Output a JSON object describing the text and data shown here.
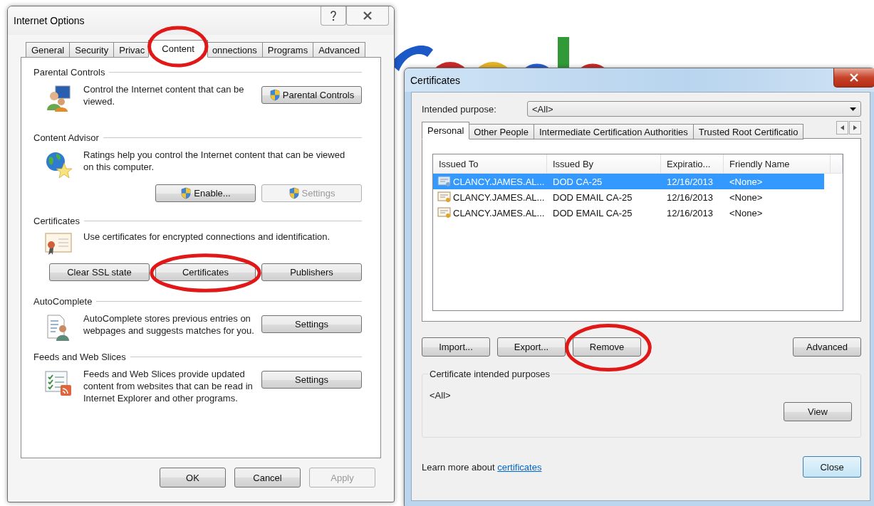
{
  "options_window": {
    "title": "Internet Options",
    "tabs": [
      {
        "label": "General",
        "selected": false
      },
      {
        "label": "Security",
        "selected": false
      },
      {
        "label": "Privac",
        "selected": false
      },
      {
        "label": "Content",
        "selected": true
      },
      {
        "label": "onnections",
        "selected": false
      },
      {
        "label": "Programs",
        "selected": false
      },
      {
        "label": "Advanced",
        "selected": false
      }
    ],
    "sections": [
      {
        "kind": "parental",
        "title": "Parental Controls",
        "text": "Control the Internet content that can be viewed.",
        "buttons": [
          {
            "label": "Parental Controls",
            "shield": true,
            "disabled": false
          }
        ]
      },
      {
        "kind": "advisor",
        "title": "Content Advisor",
        "text": "Ratings help you control the Internet content that can be viewed on this computer.",
        "buttons": [
          {
            "label": "Enable...",
            "shield": true,
            "disabled": false
          },
          {
            "label": "Settings",
            "shield": true,
            "disabled": true
          }
        ]
      },
      {
        "kind": "certificates",
        "title": "Certificates",
        "text": "Use certificates for encrypted connections and identification.",
        "buttons": [
          {
            "label": "Clear SSL state",
            "shield": false,
            "disabled": false
          },
          {
            "label": "Certificates",
            "shield": false,
            "disabled": false
          },
          {
            "label": "Publishers",
            "shield": false,
            "disabled": false
          }
        ]
      },
      {
        "kind": "autocomplete",
        "title": "AutoComplete",
        "text": "AutoComplete stores previous entries on webpages and suggests matches for you.",
        "buttons": [
          {
            "label": "Settings",
            "shield": false,
            "disabled": false
          }
        ]
      },
      {
        "kind": "feeds",
        "title": "Feeds and Web Slices",
        "text": "Feeds and Web Slices provide updated content from websites that can be read in Internet Explorer and other programs.",
        "buttons": [
          {
            "label": "Settings",
            "shield": false,
            "disabled": false
          }
        ]
      }
    ],
    "footer_buttons": [
      {
        "label": "OK",
        "disabled": false
      },
      {
        "label": "Cancel",
        "disabled": false
      },
      {
        "label": "Apply",
        "disabled": true
      }
    ]
  },
  "certificates_window": {
    "title": "Certificates",
    "purpose_label": "Intended purpose:",
    "purpose_value": "<All>",
    "tabs": [
      {
        "label": "Personal",
        "selected": true
      },
      {
        "label": "Other People",
        "selected": false
      },
      {
        "label": "Intermediate Certification Authorities",
        "selected": false
      },
      {
        "label": "Trusted Root Certificatio",
        "selected": false
      }
    ],
    "columns": [
      "Issued To",
      "Issued By",
      "Expiratio...",
      "Friendly Name"
    ],
    "rows": [
      {
        "cells": [
          "CLANCY.JAMES.AL...",
          "DOD CA-25",
          "12/16/2013",
          "<None>"
        ],
        "selected": true
      },
      {
        "cells": [
          "CLANCY.JAMES.AL...",
          "DOD EMAIL CA-25",
          "12/16/2013",
          "<None>"
        ],
        "selected": false
      },
      {
        "cells": [
          "CLANCY.JAMES.AL...",
          "DOD EMAIL CA-25",
          "12/16/2013",
          "<None>"
        ],
        "selected": false
      }
    ],
    "actions": [
      "Import...",
      "Export...",
      "Remove"
    ],
    "advanced_button": "Advanced",
    "group_title": "Certificate intended purposes",
    "group_value": "<All>",
    "view_button": "View",
    "learn_text": "Learn more about",
    "learn_link": "certificates",
    "close_button": "Close"
  }
}
